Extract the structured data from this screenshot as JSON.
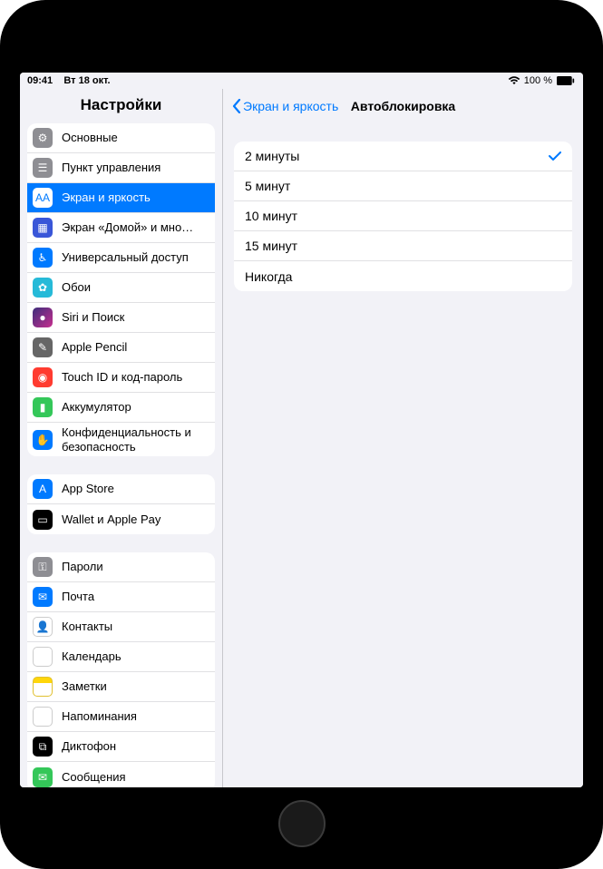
{
  "status": {
    "time": "09:41",
    "date": "Вт 18 окт.",
    "battery": "100 %"
  },
  "sidebar": {
    "title": "Настройки",
    "groups": [
      {
        "items": [
          {
            "id": "general",
            "label": "Основные",
            "icon": "gear-icon",
            "bg": "ic-general"
          },
          {
            "id": "control-center",
            "label": "Пункт управления",
            "icon": "switches-icon",
            "bg": "ic-control"
          },
          {
            "id": "display",
            "label": "Экран и яркость",
            "icon": "text-size-icon",
            "bg": "ic-display",
            "selected": true
          },
          {
            "id": "home-screen",
            "label": "Экран «Домой» и мно…",
            "icon": "apps-grid-icon",
            "bg": "ic-home"
          },
          {
            "id": "accessibility",
            "label": "Универсальный доступ",
            "icon": "accessibility-icon",
            "bg": "ic-access"
          },
          {
            "id": "wallpaper",
            "label": "Обои",
            "icon": "flower-icon",
            "bg": "ic-wallpaper"
          },
          {
            "id": "siri",
            "label": "Siri и Поиск",
            "icon": "siri-icon",
            "bg": "ic-siri"
          },
          {
            "id": "pencil",
            "label": "Apple Pencil",
            "icon": "pencil-icon",
            "bg": "ic-pencil"
          },
          {
            "id": "touchid",
            "label": "Touch ID и код-пароль",
            "icon": "fingerprint-icon",
            "bg": "ic-touchid"
          },
          {
            "id": "battery",
            "label": "Аккумулятор",
            "icon": "battery-icon",
            "bg": "ic-battery"
          },
          {
            "id": "privacy",
            "label": "Конфиденциальность и безопасность",
            "icon": "hand-icon",
            "bg": "ic-privacy",
            "wrap": true
          }
        ]
      },
      {
        "items": [
          {
            "id": "appstore",
            "label": "App Store",
            "icon": "appstore-icon",
            "bg": "ic-appstore"
          },
          {
            "id": "wallet",
            "label": "Wallet и Apple Pay",
            "icon": "wallet-icon",
            "bg": "ic-wallet"
          }
        ]
      },
      {
        "items": [
          {
            "id": "passwords",
            "label": "Пароли",
            "icon": "key-icon",
            "bg": "ic-passwords"
          },
          {
            "id": "mail",
            "label": "Почта",
            "icon": "envelope-icon",
            "bg": "ic-mail"
          },
          {
            "id": "contacts",
            "label": "Контакты",
            "icon": "person-icon",
            "bg": "ic-contacts"
          },
          {
            "id": "calendar",
            "label": "Календарь",
            "icon": "calendar-icon",
            "bg": "ic-calendar"
          },
          {
            "id": "notes",
            "label": "Заметки",
            "icon": "note-icon",
            "bg": "ic-notes"
          },
          {
            "id": "reminders",
            "label": "Напоминания",
            "icon": "list-icon",
            "bg": "ic-reminders"
          },
          {
            "id": "voice-memos",
            "label": "Диктофон",
            "icon": "waveform-icon",
            "bg": "ic-voice"
          },
          {
            "id": "messages",
            "label": "Сообщения",
            "icon": "message-icon",
            "bg": "ic-messages"
          }
        ]
      }
    ]
  },
  "detail": {
    "back_label": "Экран и яркость",
    "title": "Автоблокировка",
    "options": [
      {
        "label": "2 минуты",
        "selected": true
      },
      {
        "label": "5 минут",
        "selected": false
      },
      {
        "label": "10 минут",
        "selected": false
      },
      {
        "label": "15 минут",
        "selected": false
      },
      {
        "label": "Никогда",
        "selected": false
      }
    ]
  },
  "icons": {
    "gear-icon": "⚙︎",
    "switches-icon": "☰",
    "text-size-icon": "AA",
    "apps-grid-icon": "▦",
    "accessibility-icon": "♿︎",
    "flower-icon": "✿",
    "siri-icon": "●",
    "pencil-icon": "✎",
    "fingerprint-icon": "◉",
    "battery-icon": "▮",
    "hand-icon": "✋",
    "appstore-icon": "A",
    "wallet-icon": "▭",
    "key-icon": "⚿",
    "envelope-icon": "✉︎",
    "person-icon": "👤",
    "calendar-icon": "▦",
    "note-icon": " ",
    "list-icon": "☰",
    "waveform-icon": "⧉",
    "message-icon": "✉︎"
  }
}
